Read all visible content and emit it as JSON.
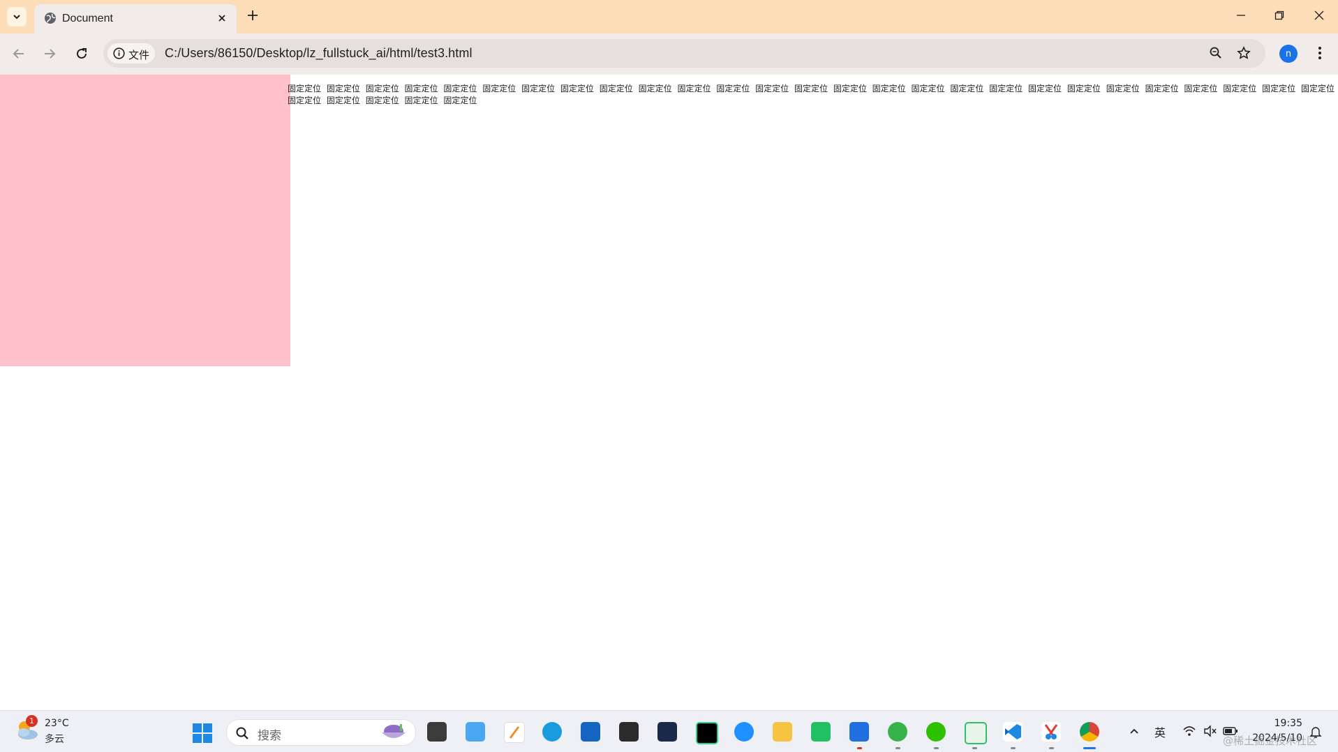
{
  "browser": {
    "tab_title": "Document",
    "url_chip_label": "文件",
    "url": "C:/Users/86150/Desktop/lz_fullstuck_ai/html/test3.html",
    "profile_initial": "n"
  },
  "page": {
    "box_color": "#ffc0cb",
    "repeated_text": "固定定位",
    "repeated_text_count": 32
  },
  "taskbar": {
    "weather_temp": "23°C",
    "weather_condition": "多云",
    "weather_badge": "1",
    "search_placeholder": "搜索",
    "ime_label": "英",
    "time": "19:35",
    "date": "2024/5/10",
    "watermark": "@稀土掘金技术社区",
    "apps": [
      "task-view-icon",
      "files-icon",
      "notes-icon",
      "edge-icon",
      "store-icon",
      "unity-icon",
      "devecoStudio-icon",
      "pycharm-icon",
      "ie-icon",
      "explorer-icon",
      "green-app-icon",
      "security-shield-icon",
      "360-browser-icon",
      "wechat-icon",
      "remote-desktop-icon",
      "vscode-icon",
      "snipping-tool-icon",
      "chrome-icon"
    ]
  }
}
